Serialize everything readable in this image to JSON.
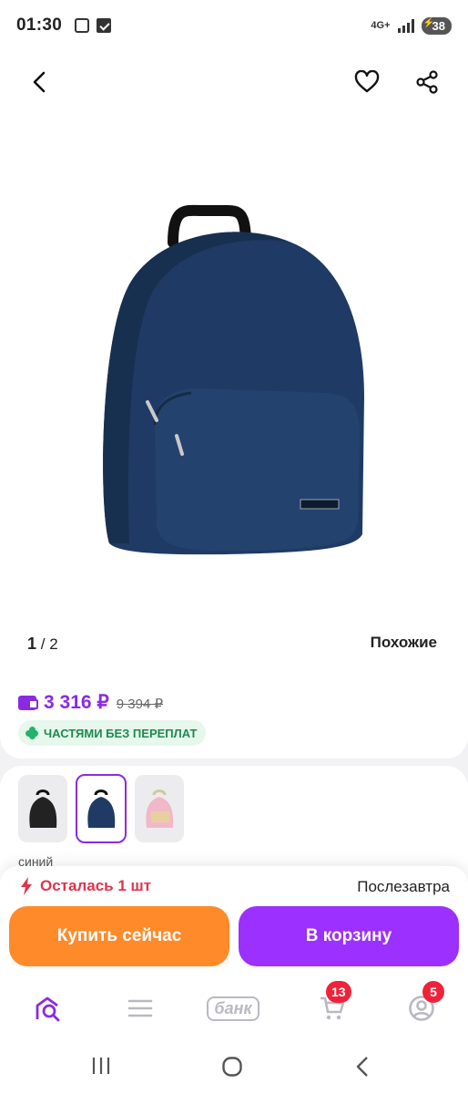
{
  "status": {
    "time": "01:30",
    "network": "4G+",
    "battery": "38"
  },
  "gallery": {
    "current": "1",
    "total": "/ 2",
    "similar_label": "Похожие"
  },
  "price": {
    "current": "3 316 ₽",
    "old": "9 394 ₽"
  },
  "installment": {
    "label": "ЧАСТЯМИ БЕЗ ПЕРЕПЛАТ"
  },
  "variants": {
    "selected_color": "синий",
    "items": [
      "black",
      "blue",
      "pink"
    ]
  },
  "stock": {
    "label": "Осталась 1 шт",
    "delivery": "Послезавтра"
  },
  "actions": {
    "buy_now": "Купить сейчас",
    "add_to_cart": "В корзину"
  },
  "tabs": {
    "bank_label": "банк",
    "cart_badge": "13",
    "profile_badge": "5"
  },
  "colors": {
    "accent": "#8a2be2",
    "buy": "#ff8a2a",
    "cart": "#9b30ff",
    "alert": "#e0334f",
    "installment": "#22b36a"
  }
}
